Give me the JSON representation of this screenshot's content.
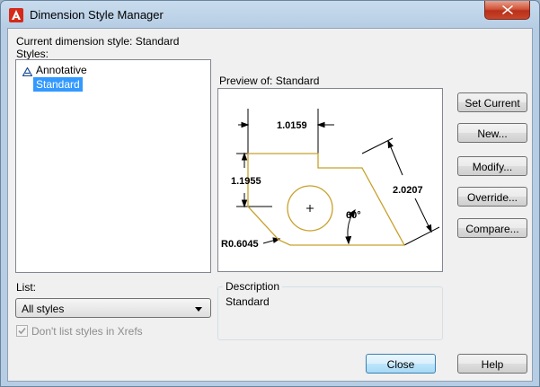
{
  "window": {
    "title": "Dimension Style Manager",
    "icon": "autocad-a-icon",
    "accent_color": "#3399ff",
    "close_button_color": "#c9452a"
  },
  "current_style": {
    "label": "Current dimension style: Standard"
  },
  "styles": {
    "label": "Styles:",
    "items": [
      {
        "name": "Annotative",
        "icon": "annotative-icon",
        "selected": false
      },
      {
        "name": "Standard",
        "selected": true
      }
    ]
  },
  "preview": {
    "label": "Preview of: Standard",
    "dimensions": {
      "top_width": "1.0159",
      "left_height": "1.1955",
      "right_length": "2.0207",
      "angle": "60°",
      "radius": "R0.6045"
    },
    "shape_color": "#c8a02a"
  },
  "list": {
    "label": "List:",
    "selected": "All styles",
    "checkbox_label": "Don't list styles in Xrefs",
    "checkbox_checked": true,
    "checkbox_disabled": true
  },
  "description": {
    "group_label": "Description",
    "text": "Standard"
  },
  "buttons": {
    "set_current": "Set Current",
    "new": "New...",
    "modify": "Modify...",
    "override": "Override...",
    "compare": "Compare...",
    "close": "Close",
    "help": "Help"
  }
}
